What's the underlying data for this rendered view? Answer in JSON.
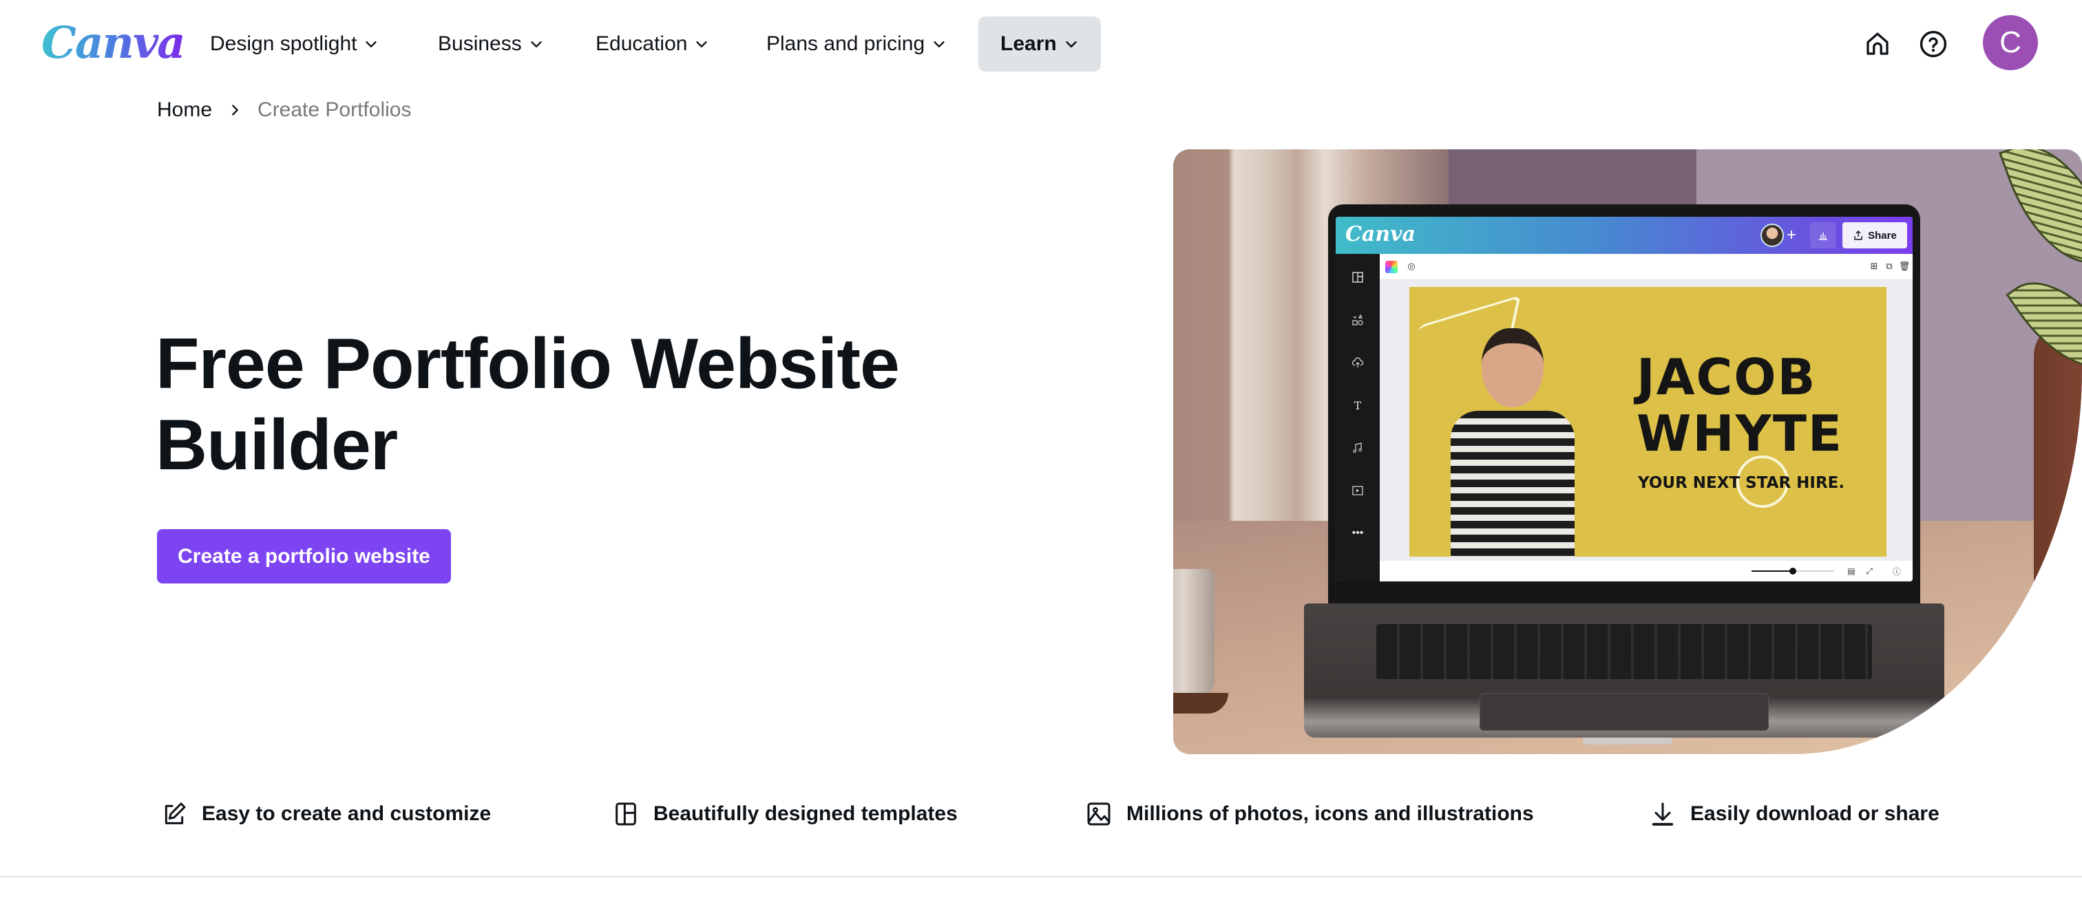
{
  "brand": {
    "logo_text": "Canva",
    "accent_color": "#7d44f2",
    "text_color": "#0e1318"
  },
  "nav": {
    "items": [
      {
        "label": "Design spotlight",
        "icon": "chevron-down-icon"
      },
      {
        "label": "Business",
        "icon": "chevron-down-icon"
      },
      {
        "label": "Education",
        "icon": "chevron-down-icon"
      },
      {
        "label": "Plans and pricing",
        "icon": "chevron-down-icon"
      },
      {
        "label": "Learn",
        "icon": "chevron-down-icon",
        "active": true
      }
    ],
    "right_icons": [
      "home-icon",
      "help-icon"
    ],
    "avatar_initial": "C",
    "avatar_color": "#9b4fb5"
  },
  "breadcrumb": {
    "home": "Home",
    "separator_icon": "chevron-right-icon",
    "current": "Create Portfolios"
  },
  "hero": {
    "title_line1": "Free Portfolio Website",
    "title_line2": "Builder",
    "cta_label": "Create a portfolio website",
    "image": {
      "description": "Laptop on desk showing Canva editor with portfolio design",
      "editor": {
        "logo_text": "Canva",
        "plus_label": "+",
        "share_label": "Share",
        "sidebar_icons": [
          "templates-icon",
          "elements-icon",
          "uploads-icon",
          "text-icon",
          "audio-icon",
          "videos-icon",
          "more-icon"
        ],
        "toolbar_icons": [
          "color-picker-icon",
          "style-icon",
          "add-page-icon",
          "duplicate-page-icon",
          "delete-icon"
        ],
        "design": {
          "name_line1": "JACOB",
          "name_line2": "WHYTE",
          "tagline": "YOUR NEXT STAR HIRE.",
          "background_color": "#dcc047"
        },
        "zoom_slider_fraction": 0.5,
        "bottom_icons": [
          "grid-view-icon",
          "fullscreen-icon",
          "help-icon"
        ]
      }
    }
  },
  "features": [
    {
      "icon": "edit-icon",
      "label": "Easy to create and customize"
    },
    {
      "icon": "layout-icon",
      "label": "Beautifully designed templates"
    },
    {
      "icon": "image-icon",
      "label": "Millions of photos, icons and illustrations"
    },
    {
      "icon": "download-icon",
      "label": "Easily download or share"
    }
  ]
}
